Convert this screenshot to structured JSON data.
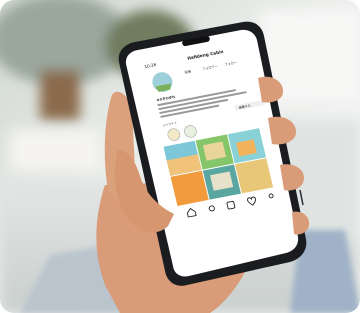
{
  "scene": {
    "subject": "hand holding smartphone showing a social media profile",
    "background_colors": {
      "wall": "#eef0ef",
      "blur_left": "#9aa79c",
      "blur_plant": "#6f7d5f",
      "table": "#cfd3d1"
    },
    "skin_color": "#d99b78",
    "phone_body_color": "#1b1c20"
  },
  "phone_screen": {
    "status_time": "10:26",
    "profile_name": "Hafideng Cabin",
    "stat_labels": [
      "投稿",
      "フォロワー",
      "フォロー"
    ],
    "bio_heading": "#かぞのゆれ",
    "edit_label": "編集する",
    "highlight_label": "ハイライト",
    "nav_icons": [
      "home-icon",
      "search-icon",
      "reels-icon",
      "heart-icon",
      "profile-icon"
    ]
  }
}
